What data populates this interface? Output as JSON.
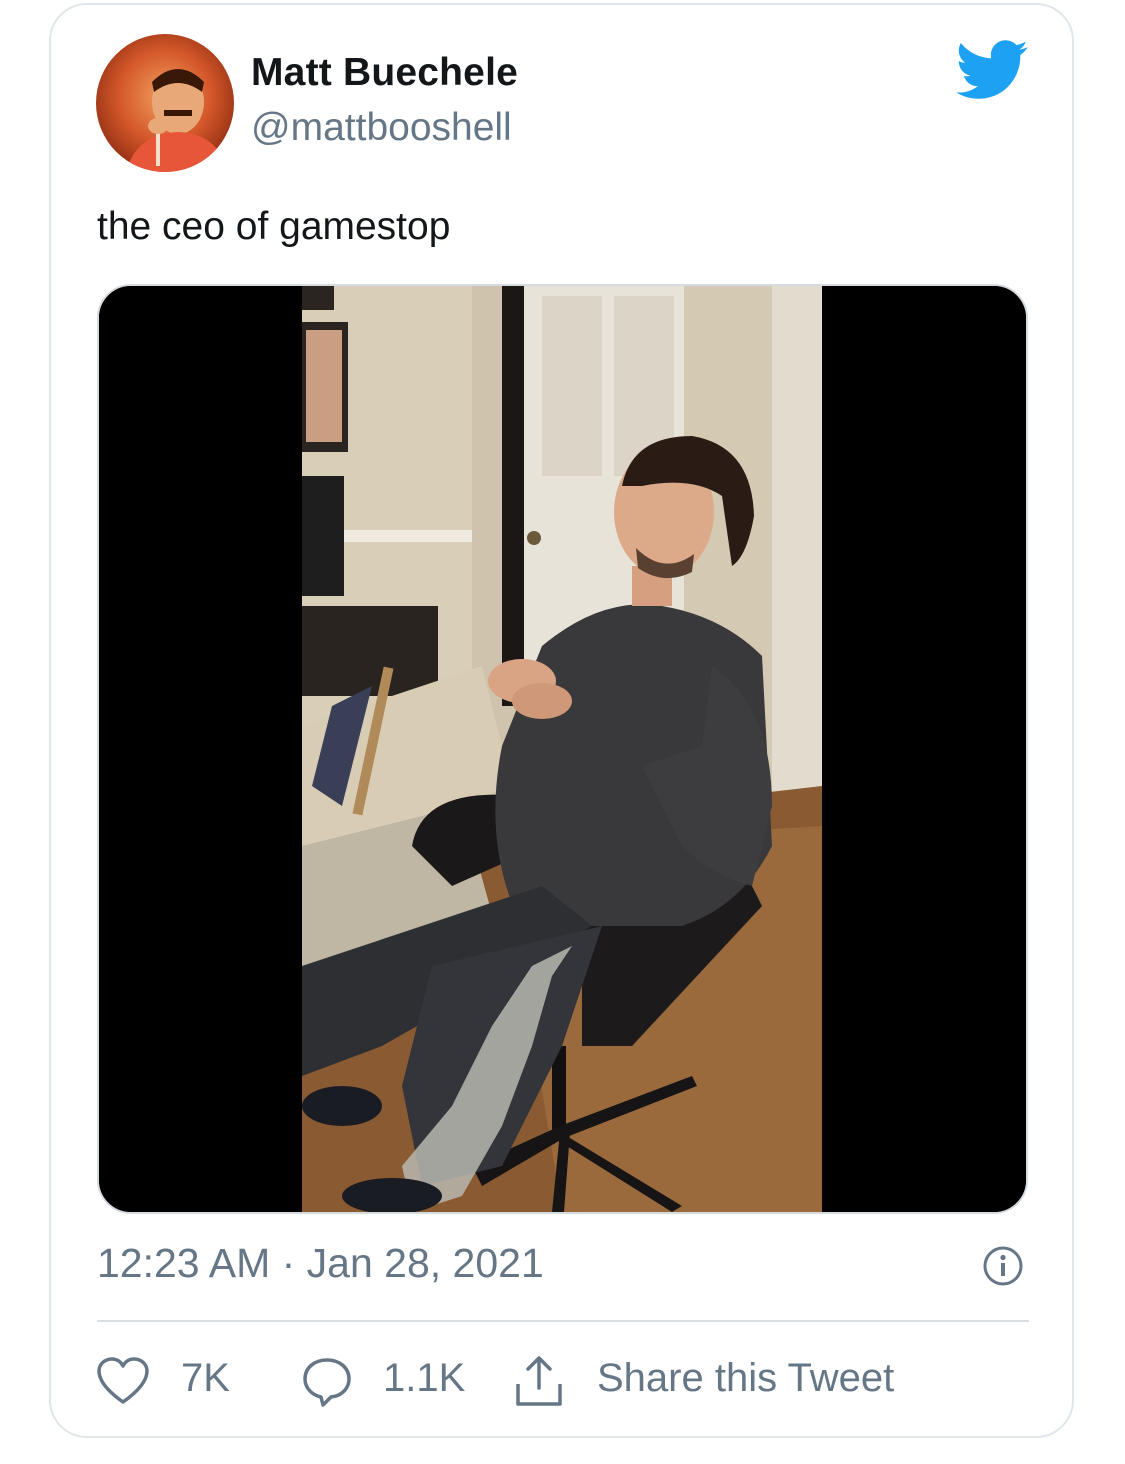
{
  "tweet": {
    "author": {
      "display_name": "Matt Buechele",
      "handle": "@mattbooshell"
    },
    "text": "the ceo of gamestop",
    "timestamp": "12:23 AM · Jan 28, 2021",
    "actions": {
      "likes": "7K",
      "replies": "1.1K",
      "share_label": "Share this Tweet"
    }
  },
  "icons": {
    "brand": "twitter-bird-icon",
    "info": "info-icon",
    "like": "heart-icon",
    "reply": "speech-bubble-icon",
    "share": "share-arrow-icon"
  },
  "colors": {
    "twitter_blue": "#1da1f2",
    "secondary_text": "#657786",
    "primary_text": "#14171a"
  }
}
